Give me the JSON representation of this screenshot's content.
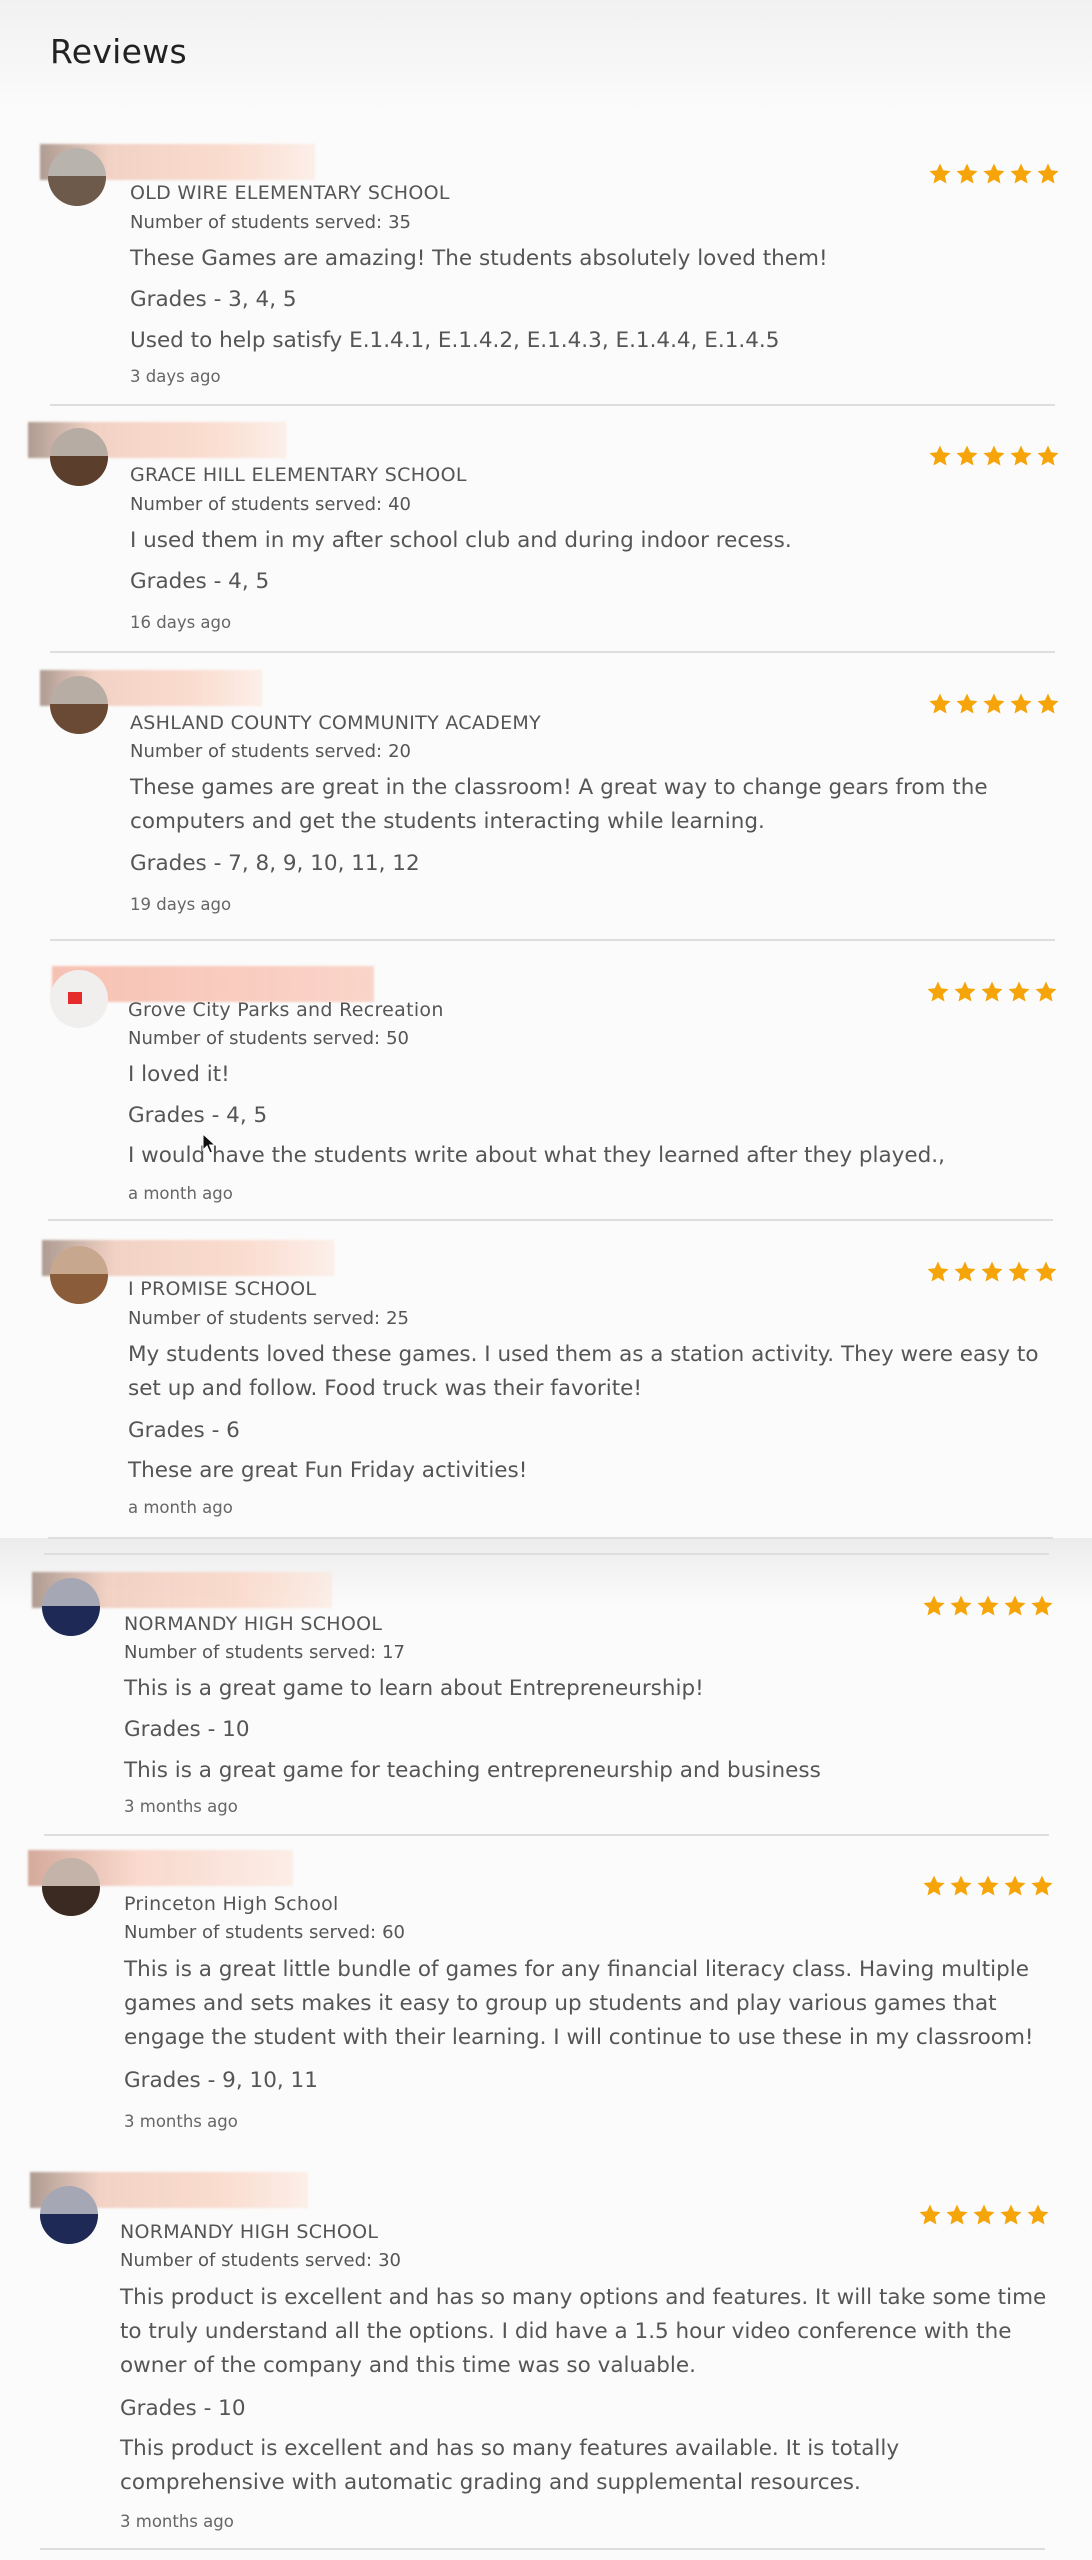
{
  "page": {
    "title": "Reviews",
    "star_color": "#f5a50a",
    "served_label": "Number of students served:"
  },
  "reviews": [
    {
      "school": "OLD WIRE ELEMENTARY SCHOOL",
      "students_served": "35",
      "rating": 5,
      "text": "These Games are amazing! The students absolutely loved them!",
      "grades": "Grades - 3, 4, 5",
      "note": "Used to help satisfy E.1.4.1, E.1.4.2, E.1.4.3, E.1.4.4, E.1.4.5",
      "date": "3 days ago"
    },
    {
      "school": "GRACE HILL ELEMENTARY SCHOOL",
      "students_served": "40",
      "rating": 5,
      "text": "I used them in my after school club and during indoor recess.",
      "grades": "Grades - 4, 5",
      "date": "16 days ago"
    },
    {
      "school": "ASHLAND COUNTY COMMUNITY ACADEMY",
      "students_served": "20",
      "rating": 5,
      "text": "These games are great in the classroom! A great way to change gears from the computers and get the students interacting while learning.",
      "grades": "Grades - 7, 8, 9, 10, 11, 12",
      "date": "19 days ago"
    },
    {
      "school": "Grove City Parks and Recreation",
      "students_served": "50",
      "rating": 5,
      "text": "I loved it!",
      "grades": "Grades - 4, 5",
      "note": "I would have the students write about what they learned after they played.,",
      "date": "a month ago"
    },
    {
      "school": "I PROMISE SCHOOL",
      "students_served": "25",
      "rating": 5,
      "text": "My students loved these games. I used them as a station activity. They were easy to set up and follow. Food truck was their favorite!",
      "grades": "Grades - 6",
      "note": "These are great Fun Friday activities!",
      "date": "a month ago"
    },
    {
      "school": "NORMANDY HIGH SCHOOL",
      "students_served": "17",
      "rating": 5,
      "text": "This is a great game to learn about Entrepreneurship!",
      "grades": "Grades - 10",
      "note": "This is a great game for teaching entrepreneurship and business",
      "date": "3 months ago"
    },
    {
      "school": "Princeton High School",
      "students_served": "60",
      "rating": 5,
      "text": "This is a great little bundle of games for any financial literacy class. Having multiple games and sets makes it easy to group up students and play various games that engage the student with their learning. I will continue to use these in my classroom!",
      "grades": "Grades - 9, 10, 11",
      "date": "3 months ago"
    },
    {
      "school": "NORMANDY HIGH SCHOOL",
      "students_served": "30",
      "rating": 5,
      "text": "This product is excellent and has so many options and features. It will take some time to truly understand all the options. I did have a 1.5 hour video conference with the owner of the company and this time was so valuable.",
      "grades": "Grades - 10",
      "note": "This product is excellent and has so many features available. It is totally comprehensive with automatic grading and supplemental resources.",
      "date": "3 months ago"
    }
  ]
}
